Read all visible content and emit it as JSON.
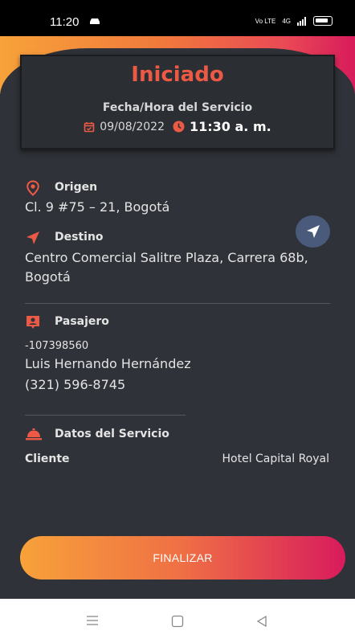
{
  "statusbar": {
    "time": "11:20",
    "network": "4G"
  },
  "card": {
    "status": "Iniciado",
    "datetime_label": "Fecha/Hora del Servicio",
    "date": "09/08/2022",
    "time": "11:30 a. m."
  },
  "origin": {
    "label": "Origen",
    "address": "Cl. 9 #75 – 21, Bogotá"
  },
  "destination": {
    "label": "Destino",
    "address_line1": "Centro Comercial Salitre Plaza, Carrera 68b,",
    "address_line2": "Bogotá"
  },
  "passenger": {
    "label": "Pasajero",
    "id": "-107398560",
    "name": "Luis Hernando Hernández",
    "phone": "(321) 596-8745"
  },
  "service": {
    "label": "Datos del Servicio",
    "client_label": "Cliente",
    "client_value": "Hotel Capital Royal"
  },
  "actions": {
    "finish_label": "FINALIZAR"
  },
  "colors": {
    "accent": "#ec5a45",
    "background": "#2f3238",
    "gradient_start": "#f7a23a",
    "gradient_end": "#d81b5c"
  },
  "icons": [
    "calendar-icon",
    "clock-icon",
    "location-pin-icon",
    "navigation-arrow-icon",
    "passenger-badge-icon",
    "service-bell-icon"
  ]
}
